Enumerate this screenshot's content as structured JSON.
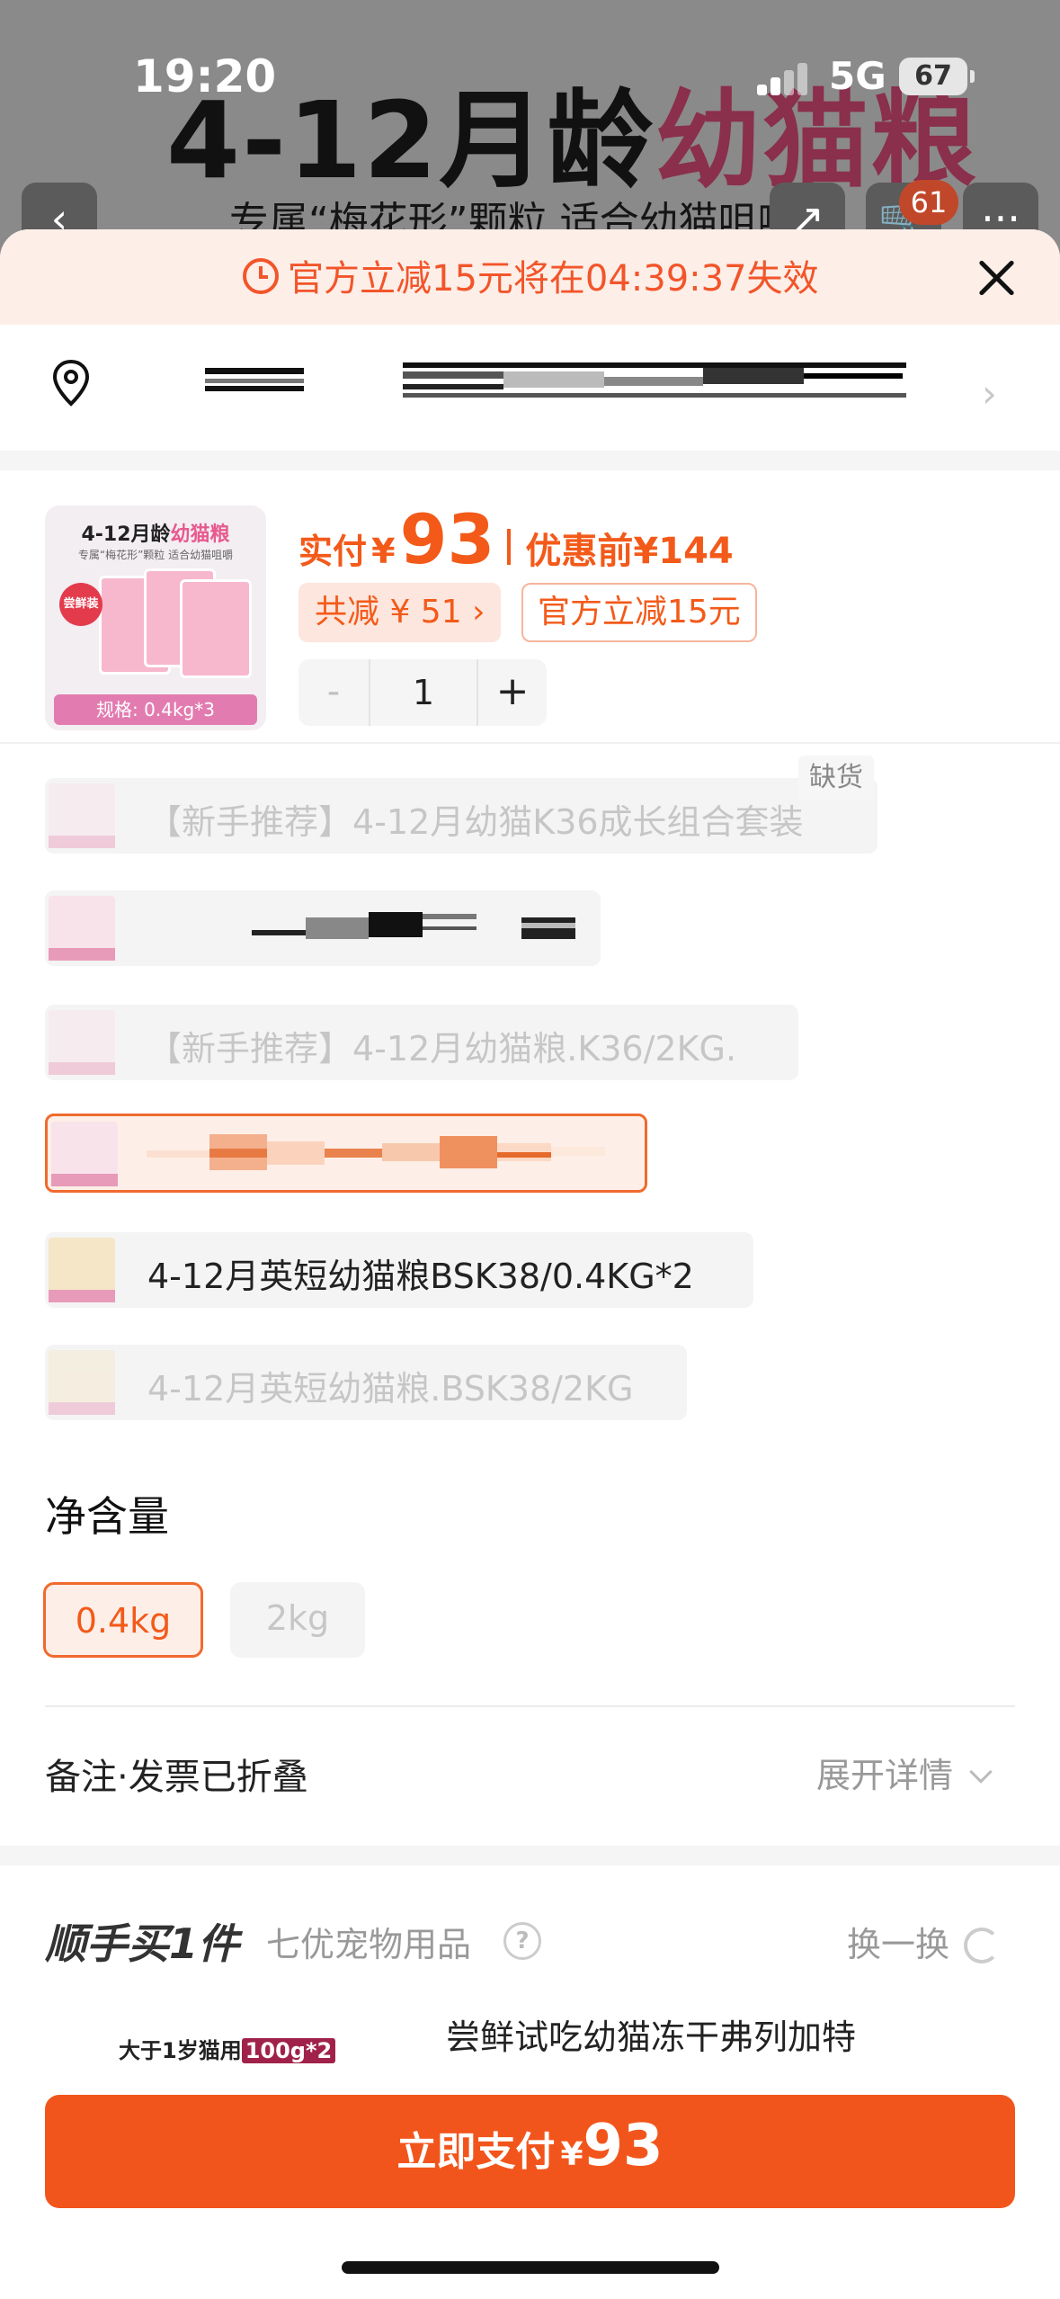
{
  "status_bar": {
    "time": "19:20",
    "network": "5G",
    "battery": "67"
  },
  "background_page": {
    "banner_title_black": "4-12月龄",
    "banner_title_pink": "幼猫粮",
    "banner_subtitle": "专属“梅花形”颗粒 适合幼猫咀嚼",
    "cart_count": "61",
    "icons": [
      "back-icon",
      "share-icon",
      "cart-icon",
      "more-icon"
    ]
  },
  "promo_bar": {
    "text": "官方立减15元将在04:39:37失效",
    "icon": "clock-icon"
  },
  "address": {
    "icon": "location-pin-icon",
    "redacted": true
  },
  "product": {
    "thumb": {
      "title_black": "4-12月龄",
      "title_pink": "幼猫粮",
      "subtitle": "专属“梅花形”颗粒 适合幼猫咀嚼",
      "badge": "尝鲜装",
      "spec": "规格: 0.4kg*3"
    },
    "price_label": "实付",
    "price_currency": "¥",
    "price_value": "93",
    "original_label": "优惠前",
    "original_price": "¥144",
    "discount_tag": "共减 ¥ 51",
    "official_tag": "官方立减15元",
    "quantity": "1",
    "minus": "-",
    "plus": "+"
  },
  "variants": [
    {
      "label": "【新手推荐】4-12月幼猫K36成长组合套装",
      "state": "disabled",
      "out_of_stock": "缺货"
    },
    {
      "label": "",
      "state": "redacted"
    },
    {
      "label": "【新手推荐】4-12月幼猫粮.K36/2KG.",
      "state": "disabled"
    },
    {
      "label": "",
      "state": "selected-redacted"
    },
    {
      "label": "4-12月英短幼猫粮BSK38/0.4KG*2",
      "state": "available"
    },
    {
      "label": "4-12月英短幼猫粮.BSK38/2KG",
      "state": "disabled"
    }
  ],
  "net_weight": {
    "title": "净含量",
    "options": [
      {
        "label": "0.4kg",
        "state": "selected"
      },
      {
        "label": "2kg",
        "state": "disabled"
      }
    ]
  },
  "notes": {
    "label": "备注·发票已折叠",
    "expand": "展开详情"
  },
  "addon": {
    "title": "顺手买1件",
    "shop": "七优宠物用品",
    "help": "?",
    "swap": "换一换",
    "image_text": "大于1岁猫用",
    "image_badge": "100g*2",
    "product_name": "尝鲜试吃幼猫冻干弗列加特"
  },
  "pay_button": {
    "label": "立即支付",
    "currency": "¥",
    "amount": "93"
  },
  "colors": {
    "accent": "#f2551c",
    "accent_light": "#fdefe8",
    "promo_bg": "#fdeee8"
  }
}
